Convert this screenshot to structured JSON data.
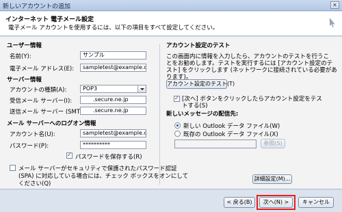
{
  "window": {
    "title": "新しいアカウントの追加",
    "close_label": "✕"
  },
  "header": {
    "title": "インターネット 電子メール設定",
    "subtitle": "電子メール アカウントを使用するには、以下の項目をすべて設定してください。"
  },
  "user_info": {
    "heading": "ユーザー情報",
    "name_label": "名前(Y):",
    "name_value": "サンプル",
    "email_label": "電子メール アドレス(E):",
    "email_value": "sampletest@example.com"
  },
  "server_info": {
    "heading": "サーバー情報",
    "account_type_label": "アカウントの種類(A):",
    "account_type_value": "POP3",
    "incoming_label": "受信メール サーバー(I):",
    "incoming_value": ".secure.ne.jp",
    "outgoing_label": "送信メール サーバー (SMTP)(O):",
    "outgoing_value": ".secure.ne.jp"
  },
  "logon_info": {
    "heading": "メール サーバーへのログオン情報",
    "account_name_label": "アカウント名(U):",
    "account_name_value": "sampletest@example.com",
    "password_label": "パスワード(P):",
    "password_value": "**********",
    "save_password_label": "パスワードを保存する(R)",
    "save_password_checked": true,
    "spa_label_line1": "メール サーバーがセキュリティで保護されたパスワード認証",
    "spa_label_line2": "(SPA) に対応している場合には、チェック ボックスをオンにして",
    "spa_label_line3": "ください(Q)",
    "spa_checked": false
  },
  "test_settings": {
    "heading": "アカウント設定のテスト",
    "desc_line1": "この画面内に情報を入力したら、アカウントのテストを行うこ",
    "desc_line2": "とをお勧めします。テストを実行するには [アカウント設定のテ",
    "desc_line3": "スト] をクリックします (ネットワークに接続されている必要があ",
    "desc_line4": "ります)。",
    "test_button": "アカウント設定のテスト(T)",
    "auto_test_line1": "[次へ] ボタンをクリックしたらアカウント設定をテス",
    "auto_test_line2": "トする(S)",
    "auto_test_checked": true
  },
  "delivery": {
    "heading": "新しいメッセージの配信先:",
    "option_new": "新しい Outlook データ ファイル(W)",
    "option_existing": "既存の Outlook データ ファイル(X)",
    "selected": "new",
    "browse_button": "参照(S)",
    "details_button": "詳細設定(M)..."
  },
  "footer": {
    "back_button": "< 戻る(B)",
    "next_button": "次へ(N) >",
    "cancel_button": "キャンセル"
  }
}
